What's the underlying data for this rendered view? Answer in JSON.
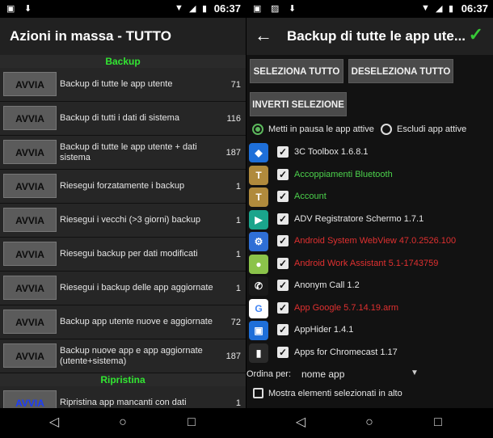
{
  "left": {
    "status_time": "06:37",
    "title": "Azioni in massa - TUTTO",
    "run_label": "AVVIA",
    "backup_section": "Backup",
    "backup_rows": [
      {
        "label": "Backup di tutte le app utente",
        "count": "71"
      },
      {
        "label": "Backup di tutti i dati di sistema",
        "count": "116"
      },
      {
        "label": "Backup di tutte le app utente + dati sistema",
        "count": "187"
      },
      {
        "label": "Riesegui forzatamente i backup",
        "count": "1"
      },
      {
        "label": "Riesegui i vecchi (>3 giorni) backup",
        "count": "1"
      },
      {
        "label": "Riesegui backup per dati modificati",
        "count": "1"
      },
      {
        "label": "Riesegui i backup delle app aggiornate",
        "count": "1"
      },
      {
        "label": "Backup app utente nuove e aggiornate",
        "count": "72"
      },
      {
        "label": "Backup nuove app e app aggiornate (utente+sistema)",
        "count": "187"
      }
    ],
    "restore_section": "Ripristina",
    "restore_rows": [
      {
        "label": "Ripristina app mancanti con dati",
        "count": "1"
      }
    ]
  },
  "right": {
    "status_time": "06:37",
    "title": "Backup di tutte le app ute...",
    "buttons": {
      "select_all": "SELEZIONA TUTTO",
      "deselect_all": "DESELEZIONA TUTTO",
      "invert": "INVERTI SELEZIONE"
    },
    "radio_pause": "Metti in pausa le app attive",
    "radio_exclude": "Escludi app attive",
    "apps": [
      {
        "name": "3C Toolbox 1.6.8.1",
        "color": "#e6e6e6",
        "icon": "toolbox-icon",
        "icon_bg": "#1e6fd9",
        "glyph": "◆"
      },
      {
        "name": "Accoppiamenti Bluetooth",
        "color": "#4cd24c",
        "icon": "titanium-icon",
        "icon_bg": "#b08a3c",
        "glyph": "T"
      },
      {
        "name": "Account",
        "color": "#4cd24c",
        "icon": "titanium-icon",
        "icon_bg": "#b08a3c",
        "glyph": "T"
      },
      {
        "name": "ADV Registratore Schermo 1.7.1",
        "color": "#e6e6e6",
        "icon": "camera-icon",
        "icon_bg": "#1aa58c",
        "glyph": "▶"
      },
      {
        "name": "Android System WebView 47.0.2526.100",
        "color": "#e03030",
        "icon": "gear-icon",
        "icon_bg": "#2f6fd6",
        "glyph": "⚙"
      },
      {
        "name": "Android Work Assistant 5.1-1743759",
        "color": "#e03030",
        "icon": "android-icon",
        "icon_bg": "#8bc34a",
        "glyph": "●"
      },
      {
        "name": "Anonym Call 1.2",
        "color": "#e6e6e6",
        "icon": "phone-icon",
        "icon_bg": "#1a1a1a",
        "glyph": "✆"
      },
      {
        "name": "App Google 5.7.14.19.arm",
        "color": "#e03030",
        "icon": "google-icon",
        "icon_bg": "#ffffff",
        "glyph": "G"
      },
      {
        "name": "AppHider 1.4.1",
        "color": "#e6e6e6",
        "icon": "apphider-icon",
        "icon_bg": "#1e6fd9",
        "glyph": "▣"
      },
      {
        "name": "Apps for Chromecast 1.17",
        "color": "#e6e6e6",
        "icon": "chromecast-icon",
        "icon_bg": "#2a2a2a",
        "glyph": "▮"
      }
    ],
    "sort_label": "Ordina per:",
    "sort_value": "nome app",
    "show_selected": "Mostra elementi selezionati in alto"
  }
}
